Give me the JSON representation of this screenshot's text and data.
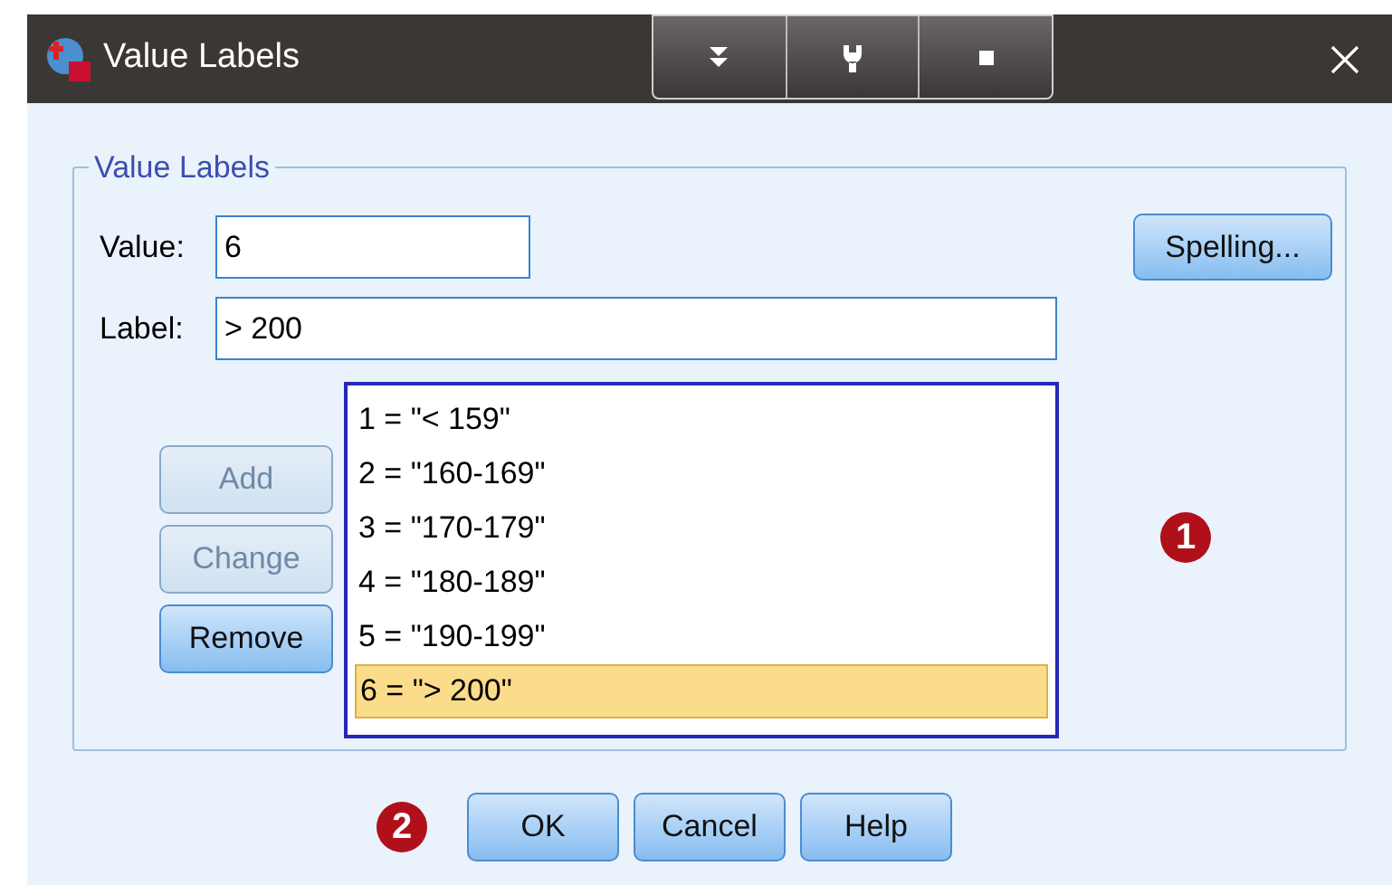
{
  "window": {
    "title": "Value Labels"
  },
  "group": {
    "title": "Value Labels"
  },
  "value_field": {
    "label": "Value:",
    "value": "6"
  },
  "label_field": {
    "label": "Label:",
    "value": "> 200"
  },
  "spelling_button": {
    "label": "Spelling...",
    "disabled": false
  },
  "side_buttons": [
    {
      "label": "Add",
      "disabled": true
    },
    {
      "label": "Change",
      "disabled": true
    },
    {
      "label": "Remove",
      "disabled": false
    }
  ],
  "list": [
    {
      "text": "1 = \"< 159\"",
      "selected": false
    },
    {
      "text": "2 = \"160-169\"",
      "selected": false
    },
    {
      "text": "3 = \"170-179\"",
      "selected": false
    },
    {
      "text": "4 = \"180-189\"",
      "selected": false
    },
    {
      "text": "5 = \"190-199\"",
      "selected": false
    },
    {
      "text": "6 = \"> 200\"",
      "selected": true
    }
  ],
  "callouts": [
    "1",
    "2"
  ],
  "buttons": [
    {
      "label": "OK"
    },
    {
      "label": "Cancel"
    },
    {
      "label": "Help"
    }
  ]
}
